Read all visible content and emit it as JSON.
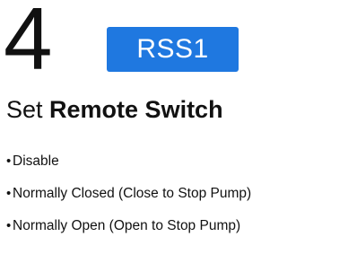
{
  "step": {
    "number": "4"
  },
  "badge": {
    "code": "RSS1",
    "color": "#1f78e0"
  },
  "heading": {
    "prefix": "Set ",
    "emphasis": "Remote Switch"
  },
  "options": [
    {
      "bullet": "•",
      "label": "Disable"
    },
    {
      "bullet": "•",
      "label": "Normally Closed (Close to Stop Pump)"
    },
    {
      "bullet": "•",
      "label": "Normally Open (Open to Stop Pump)"
    }
  ]
}
